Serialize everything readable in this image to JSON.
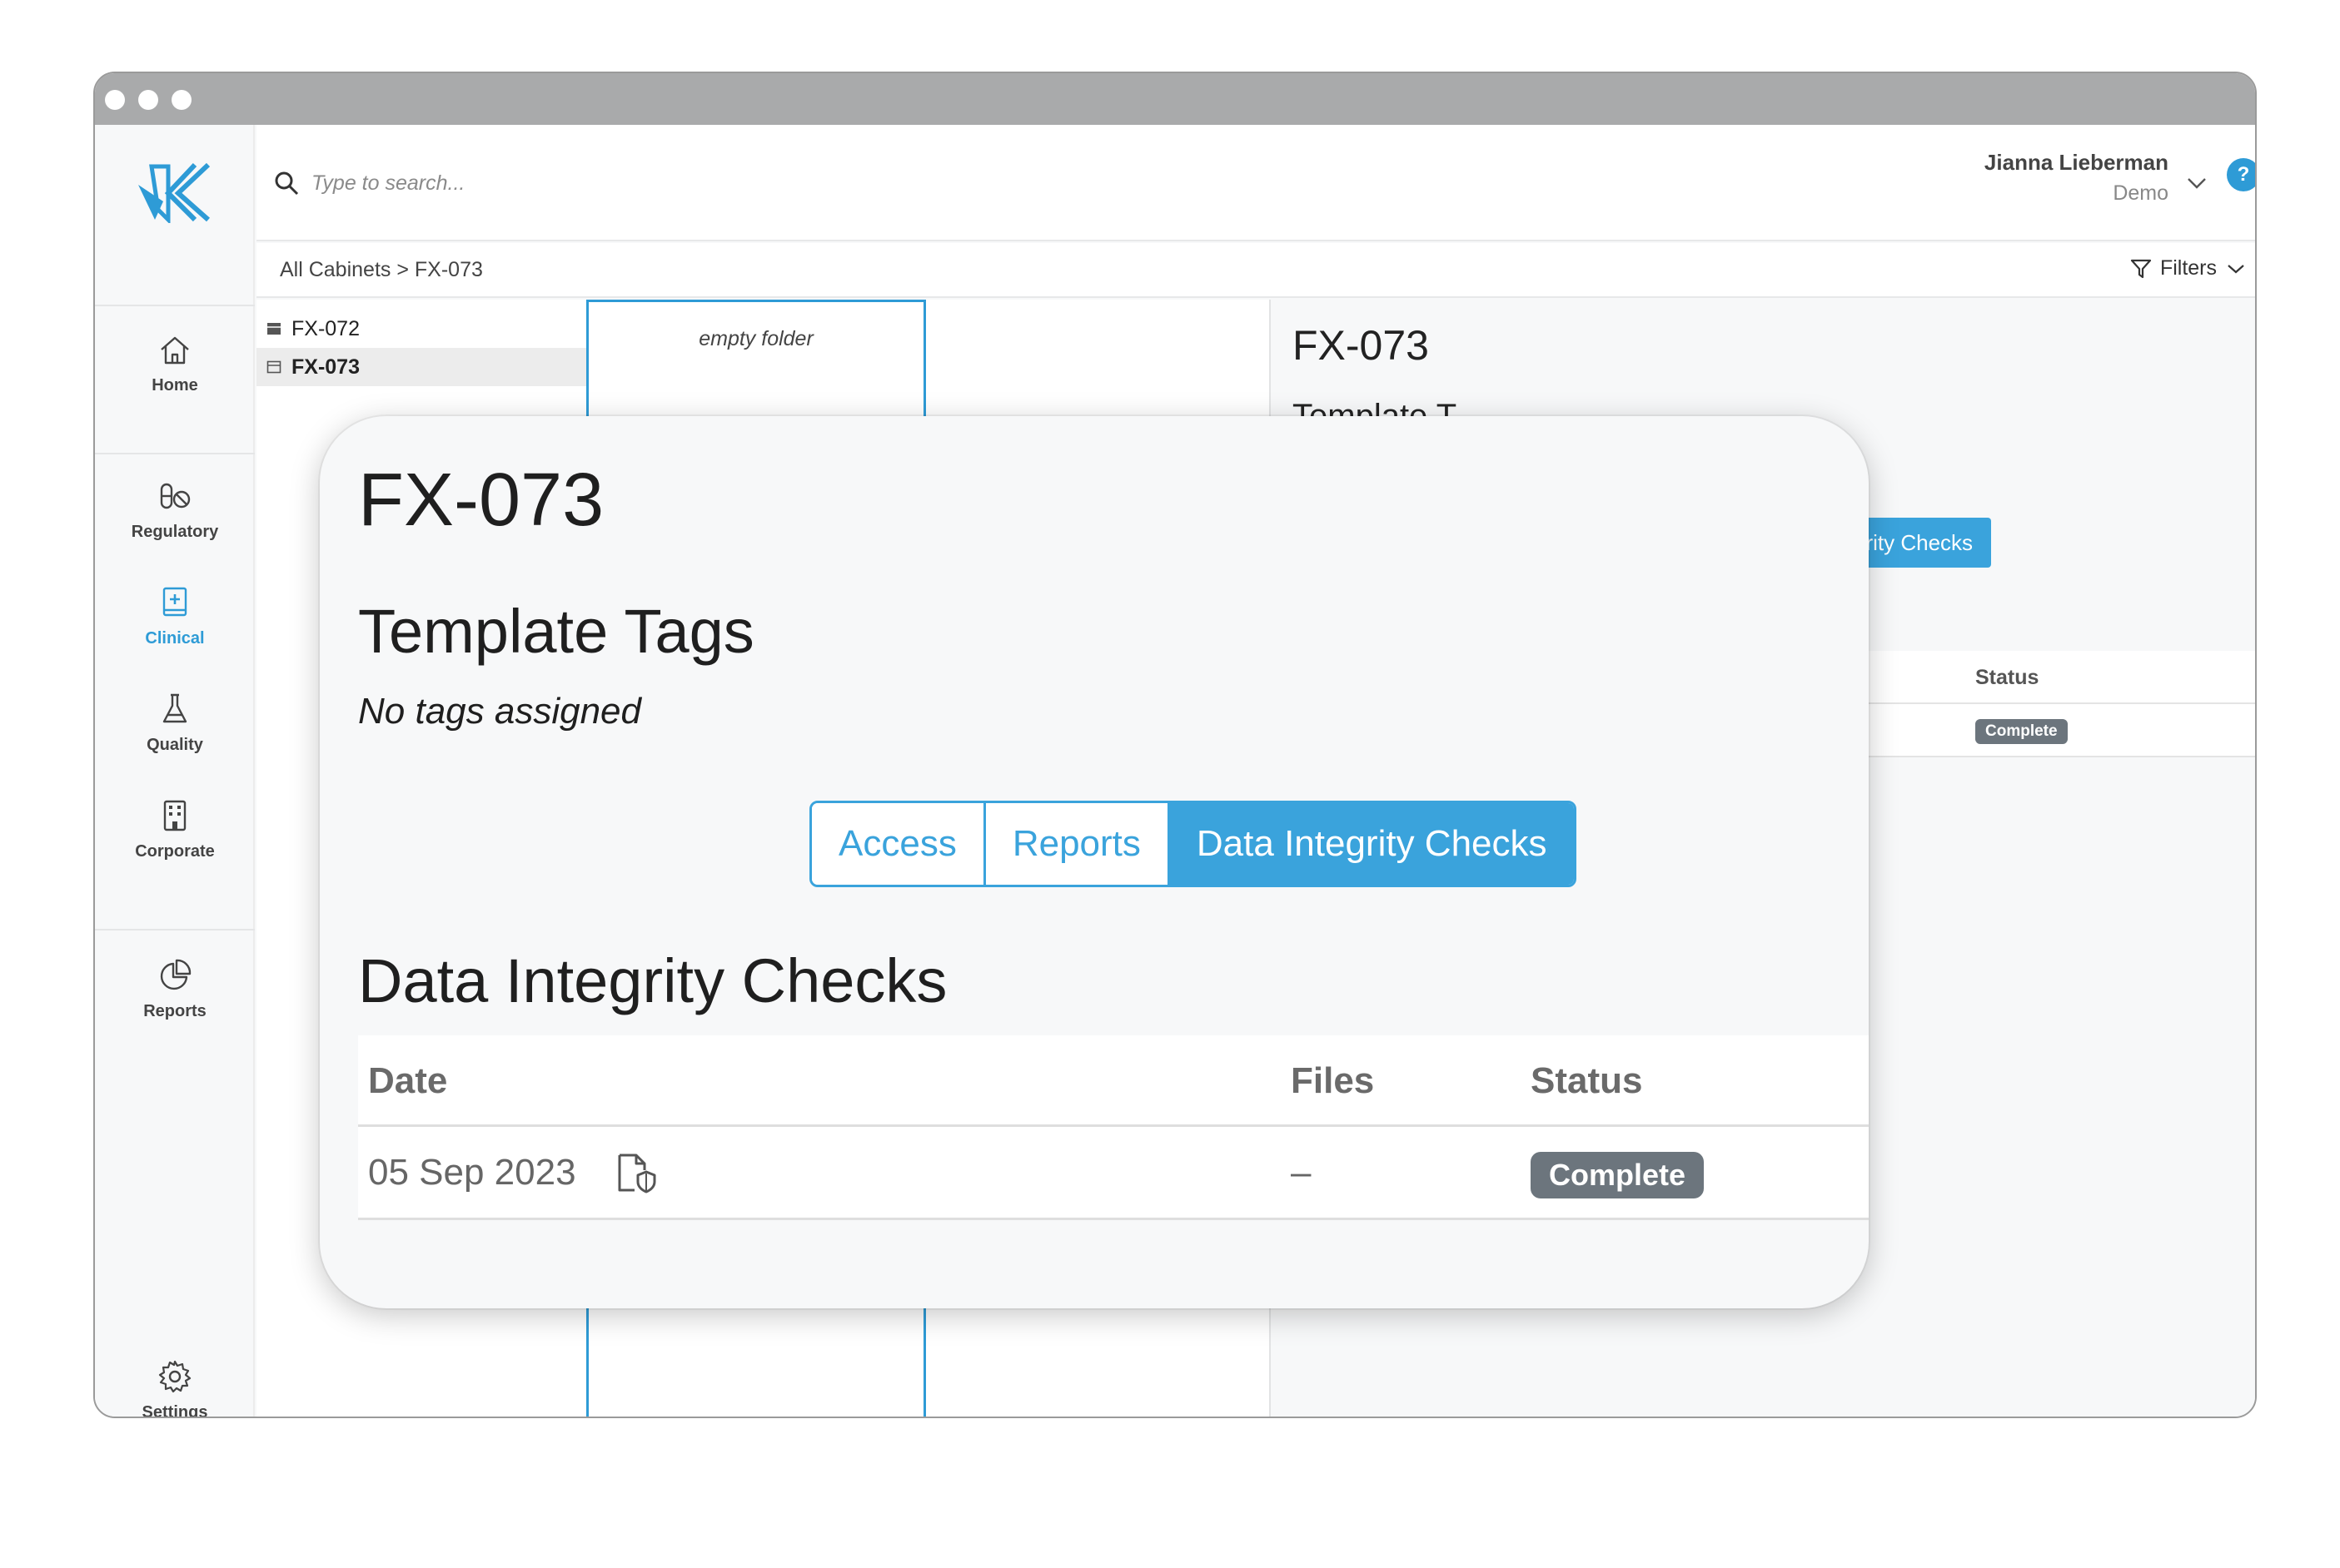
{
  "search": {
    "placeholder": "Type to search..."
  },
  "user": {
    "name": "Jianna Lieberman",
    "org": "Demo",
    "help": "?"
  },
  "nav": {
    "home": "Home",
    "regulatory": "Regulatory",
    "clinical": "Clinical",
    "quality": "Quality",
    "corporate": "Corporate",
    "reports": "Reports",
    "settings": "Settings"
  },
  "breadcrumb": "All Cabinets > FX-073",
  "filters_label": "Filters",
  "tree": [
    {
      "label": "FX-072",
      "selected": false
    },
    {
      "label": "FX-073",
      "selected": true
    }
  ],
  "column": {
    "empty_text": "empty folder"
  },
  "detail": {
    "title": "FX-073",
    "subtitle": "Template T",
    "active_tab_partial": "grity Checks",
    "status_header": "Status",
    "status_value": "Complete"
  },
  "modal": {
    "title": "FX-073",
    "tags_heading": "Template Tags",
    "tags_empty": "No tags assigned",
    "tabs": [
      {
        "label": "Access",
        "active": false
      },
      {
        "label": "Reports",
        "active": false
      },
      {
        "label": "Data Integrity Checks",
        "active": true
      }
    ],
    "section_heading": "Data Integrity Checks",
    "table": {
      "headers": {
        "date": "Date",
        "files": "Files",
        "status": "Status"
      },
      "rows": [
        {
          "date": "05 Sep 2023",
          "files": "–",
          "status": "Complete"
        }
      ]
    }
  },
  "colors": {
    "accent": "#3aa3dc",
    "badge": "#6c757d"
  }
}
